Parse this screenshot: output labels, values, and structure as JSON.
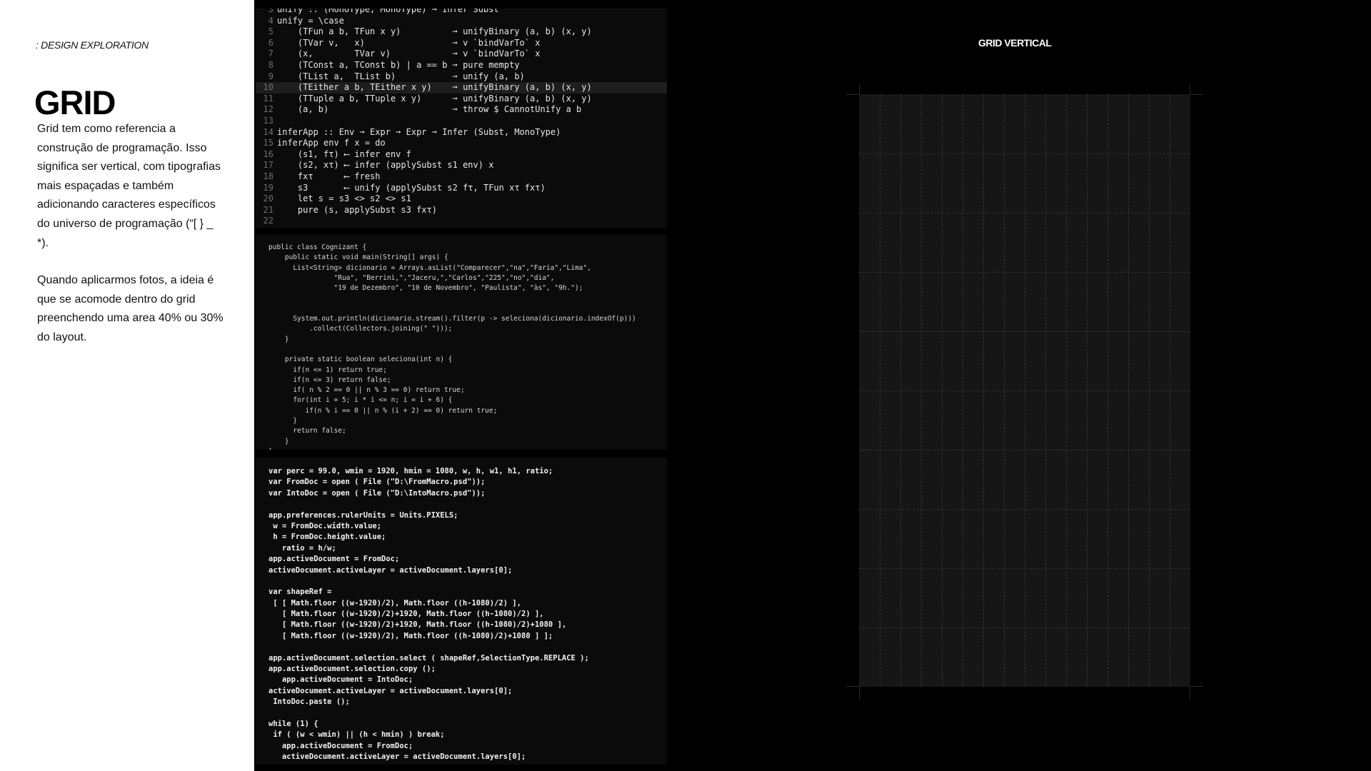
{
  "left": {
    "eyebrow": ": DESIGN EXPLORATION",
    "title": "GRID",
    "paragraph1": "Grid tem como referencia a construção de programação. Isso significa ser vertical, com tipografias mais espaçadas e também adicionando caracteres específicos do universo de programação (“[ } _ *).",
    "paragraph2": "Quando aplicarmos fotos, a ideia é que se acomode dentro do grid preenchendo uma area 40% ou 30% do layout."
  },
  "code_haskell": [
    {
      "n": "3",
      "text": "unify :: (MonoType, MonoType) ➞ Infer Subst"
    },
    {
      "n": "4",
      "text": "unify = \\case"
    },
    {
      "n": "5",
      "text": "    (TFun a b, TFun x y)          ➞ unifyBinary (a, b) (x, y)"
    },
    {
      "n": "6",
      "text": "    (TVar v,   x)                 ➞ v `bindVarTo` x"
    },
    {
      "n": "7",
      "text": "    (x,        TVar v)            ➞ v `bindVarTo` x"
    },
    {
      "n": "8",
      "text": "    (TConst a, TConst b) | a == b ➞ pure mempty"
    },
    {
      "n": "9",
      "text": "    (TList a,  TList b)           ➞ unify (a, b)"
    },
    {
      "n": "10",
      "text": "    (TEither a b, TEither x y)    ➞ unifyBinary (a, b) (x, y)"
    },
    {
      "n": "11",
      "text": "    (TTuple a b, TTuple x y)      ➞ unifyBinary (a, b) (x, y)"
    },
    {
      "n": "12",
      "text": "    (a, b)                        ➞ throw $ CannotUnify a b"
    },
    {
      "n": "13",
      "text": ""
    },
    {
      "n": "14",
      "text": "inferApp :: Env ➞ Expr ➞ Expr ➞ Infer (Subst, MonoType)"
    },
    {
      "n": "15",
      "text": "inferApp env f x = do"
    },
    {
      "n": "16",
      "text": "    (s1, fτ) ⟵ infer env f"
    },
    {
      "n": "17",
      "text": "    (s2, xτ) ⟵ infer (applySubst s1 env) x"
    },
    {
      "n": "18",
      "text": "    fxτ      ⟵ fresh"
    },
    {
      "n": "19",
      "text": "    s3       ⟵ unify (applySubst s2 fτ, TFun xτ fxτ)"
    },
    {
      "n": "20",
      "text": "    let s = s3 <> s2 <> s1"
    },
    {
      "n": "21",
      "text": "    pure (s, applySubst s3 fxτ)"
    },
    {
      "n": "22",
      "text": ""
    }
  ],
  "code_java": [
    "public class Cognizant {",
    "    public static void main(String[] args) {",
    "      List<String> dicionario = Arrays.asList(\"Comparecer\",\"na\",\"Faria\",\"Lima\",",
    "                \"Rua\", \"Berrini,\",\"Jaceru,\",\"Carlos\",\"225\",\"no\",\"dia\",",
    "                \"19 de Dezembro\", \"10 de Novembro\", \"Paulista\", \"às\", \"9h.\");",
    "",
    "",
    "      System.out.println(dicionario.stream().filter(p -> seleciona(dicionario.indexOf(p)))",
    "          .collect(Collectors.joining(\" \")));",
    "    }",
    "",
    "    private static boolean seleciona(int n) {",
    "      if(n <= 1) return true;",
    "      if(n <= 3) return false;",
    "      if( n % 2 == 0 || n % 3 == 0) return true;",
    "      for(int i = 5; i * i <= n; i = i + 6) {",
    "         if(n % i == 0 || n % (i + 2) == 0) return true;",
    "      }",
    "      return false;",
    "    }",
    "}"
  ],
  "code_js": [
    "var perc = 99.0, wmin = 1920, hmin = 1080, w, h, w1, h1, ratio;",
    "var FromDoc = open ( File (\"D:\\FromMacro.psd\"));",
    "var IntoDoc = open ( File (\"D:\\IntoMacro.psd\"));",
    "",
    "app.preferences.rulerUnits = Units.PIXELS;",
    " w = FromDoc.width.value;",
    " h = FromDoc.height.value;",
    "   ratio = h/w;",
    "app.activeDocument = FromDoc;",
    "activeDocument.activeLayer = activeDocument.layers[0];",
    "",
    "var shapeRef =",
    " [ [ Math.floor ((w-1920)/2), Math.floor ((h-1080)/2) ],",
    "   [ Math.floor ((w-1920)/2)+1920, Math.floor ((h-1080)/2) ],",
    "   [ Math.floor ((w-1920)/2)+1920, Math.floor ((h-1080)/2)+1080 ],",
    "   [ Math.floor ((w-1920)/2), Math.floor ((h-1080)/2)+1080 ] ];",
    "",
    "app.activeDocument.selection.select ( shapeRef,SelectionType.REPLACE );",
    "app.activeDocument.selection.copy ();",
    "   app.activeDocument = IntoDoc;",
    "activeDocument.activeLayer = activeDocument.layers[0];",
    " IntoDoc.paste ();",
    "",
    "while (1) {",
    " if ( (w < wmin) || (h < hmin) ) break;",
    "   app.activeDocument = FromDoc;",
    "   activeDocument.activeLayer = activeDocument.layers[0];"
  ],
  "grid": {
    "title": "GRID VERTICAL",
    "columns": 16,
    "rows": 10
  },
  "colors": {
    "panel_bg": "#ffffff",
    "page_bg": "#000000",
    "code_bg": "#0b0b0b",
    "grid_bg": "#161616"
  }
}
